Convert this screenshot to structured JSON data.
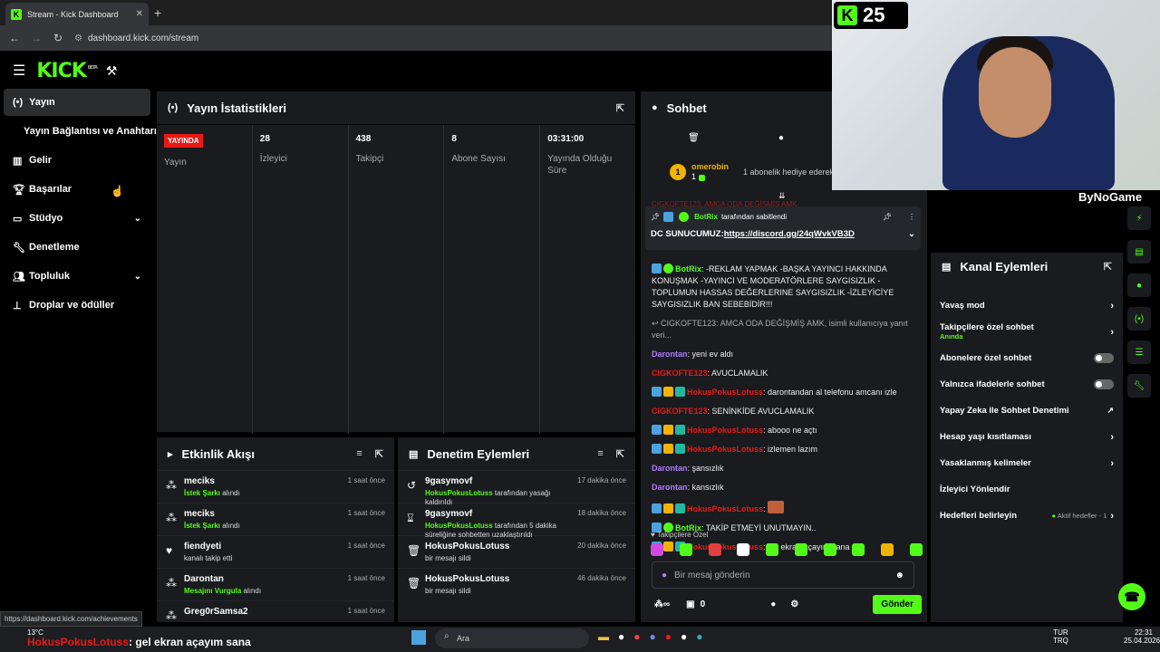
{
  "browser": {
    "tab_title": "Stream - Kick Dashboard",
    "url": "dashboard.kick.com/stream",
    "status_url": "https://dashboard.kick.com/achievements"
  },
  "topnav": {
    "logo": "KICK",
    "beta": "BETA"
  },
  "sidebar": {
    "items": [
      {
        "label": "Yayın",
        "icon": "broadcast-icon"
      },
      {
        "label": "Yayın Bağlantısı ve Anahtarı",
        "icon": ""
      },
      {
        "label": "Gelir",
        "icon": "chart-icon"
      },
      {
        "label": "Başarılar",
        "icon": "trophy-icon"
      },
      {
        "label": "Stüdyo",
        "icon": "studio-icon"
      },
      {
        "label": "Denetleme",
        "icon": "wrench-icon"
      },
      {
        "label": "Topluluk",
        "icon": "community-icon"
      },
      {
        "label": "Droplar ve ödüller",
        "icon": "drops-icon"
      }
    ]
  },
  "stats": {
    "title": "Yayın İstatistikleri",
    "live_badge": "YAYINDA",
    "cols": [
      {
        "value": "",
        "label": "Yayın"
      },
      {
        "value": "28",
        "label": "İzleyici"
      },
      {
        "value": "438",
        "label": "Takipçi"
      },
      {
        "value": "8",
        "label": "Abone Sayısı"
      },
      {
        "value": "03:31:00",
        "label": "Yayında Olduğu Süre"
      }
    ]
  },
  "activity": {
    "title": "Etkinlik Akışı",
    "rows": [
      {
        "name": "meciks",
        "hl": "İstek Şarkı",
        "rest": " alındı",
        "time": "1 saat önce"
      },
      {
        "name": "meciks",
        "hl": "İstek Şarkı",
        "rest": " alındı",
        "time": "1 saat önce"
      },
      {
        "name": "fiendyeti",
        "hl": "",
        "rest": "kanalı takip etti",
        "time": "1 saat önce"
      },
      {
        "name": "Darontan",
        "hl": "Mesajını Vurgula",
        "rest": " alındı",
        "time": "1 saat önce"
      },
      {
        "name": "Greg0rSamsa2",
        "hl": "",
        "rest": "",
        "time": "1 saat önce"
      }
    ]
  },
  "moderation": {
    "title": "Denetim Eylemleri",
    "rows": [
      {
        "name": "9gasymovf",
        "hl": "HokusPokusLotuss",
        "rest": " tarafından yasağı kaldırıldı",
        "time": "17 dakika önce"
      },
      {
        "name": "9gasymovf",
        "hl": "HokusPokusLotuss",
        "rest": " tarafından 5 dakika süreliğine sohbetten uzaklaştırıldı",
        "time": "18 dakika önce"
      },
      {
        "name": "HokusPokusLotuss",
        "hl": "",
        "rest": "bir mesajı sildi",
        "time": "20 dakika önce"
      },
      {
        "name": "HokusPokusLotuss",
        "hl": "",
        "rest": "bir mesajı sildi",
        "time": "46 dakika önce"
      }
    ]
  },
  "chat": {
    "title": "Sohbet",
    "top_user": "omerobin",
    "top_count": "1",
    "gift_text": "1 abonelik hediye ederek",
    "cut_line": "CIGKOFTE123: AMCA ODA DEĞİŞMİŞ AMK",
    "pinned_by": "BotRix",
    "pinned_by_rest": " tarafından sabitlendi",
    "pinned_msg": "DC SUNUCUMUZ: ",
    "pinned_link": "https://discord.gg/24qWvkVB3D",
    "messages": [
      {
        "user": "BotRix",
        "color": "#53fc18",
        "text": ": -REKLAM YAPMAK -BAŞKA YAYINCI HAKKINDA KONUŞMAK -YAYINCI VE MODERATÖRLERE SAYGISIZLIK -TOPLUMUN HASSAS DEĞERLERINE SAYGISIZLIK -İZLEYİCİYE SAYGISIZLIK BAN SEBEBİDİR!!!"
      },
      {
        "user": "",
        "color": "#aaa",
        "text": "↩ CIGKOFTE123: AMCA ODA DEĞİŞMİŞ AMK, isimli kullanıcıya yanıt veri..."
      },
      {
        "user": "Darontan",
        "color": "#b07cff",
        "text": ": yeni ev aldı"
      },
      {
        "user": "CIGKOFTE123",
        "color": "#e91916",
        "text": ": AVUCLAMALIK"
      },
      {
        "user": "HokusPokusLotuss",
        "color": "#e91916",
        "text": ": darontandan al telefonu amcanı izle"
      },
      {
        "user": "CIGKOFTE123",
        "color": "#e91916",
        "text": ": SENİNKİDE AVUCLAMALIK"
      },
      {
        "user": "HokusPokusLotuss",
        "color": "#e91916",
        "text": ": abooo ne açtı"
      },
      {
        "user": "HokusPokusLotuss",
        "color": "#e91916",
        "text": ": izlemen lazım"
      },
      {
        "user": "Darontan",
        "color": "#b07cff",
        "text": ": şansızlık"
      },
      {
        "user": "Darontan",
        "color": "#b07cff",
        "text": ": kansızlık"
      },
      {
        "user": "HokusPokusLotuss",
        "color": "#e91916",
        "text": ":"
      },
      {
        "user": "BotRix",
        "color": "#53fc18",
        "text": ": TAKİP ETMEYİ UNUTMAYIN.."
      },
      {
        "user": "HokusPokusLotuss",
        "color": "#e91916",
        "text": ": gel ekran açayım sana"
      }
    ],
    "emote_label": "Takipçilere Özel",
    "input_placeholder": "Bir mesaj gönderin",
    "points": "0",
    "send": "Gönder"
  },
  "kanal": {
    "title": "Kanal Eylemleri",
    "rows": [
      {
        "label": "Yavaş mod",
        "sub": "",
        "kind": "chev"
      },
      {
        "label": "Takipçilere özel sohbet",
        "sub": "Anında",
        "kind": "chev"
      },
      {
        "label": "Abonelere özel sohbet",
        "sub": "",
        "kind": "toggle"
      },
      {
        "label": "Yalnızca ifadelerle sohbet",
        "sub": "",
        "kind": "toggle"
      },
      {
        "label": "Yapay Zeka ile Sohbet Denetimi",
        "sub": "",
        "kind": "ext"
      },
      {
        "label": "Hesap yaşı kısıtlaması",
        "sub": "",
        "kind": "chev"
      },
      {
        "label": "Yasaklanmış kelimeler",
        "sub": "",
        "kind": "chev"
      },
      {
        "label": "İzleyici Yönlendir",
        "sub": "",
        "kind": "none"
      },
      {
        "label": "Hedefleri belirleyin",
        "sub": "",
        "kind": "chev",
        "extra": "Aktif hedefler - 1"
      }
    ]
  },
  "webcam": {
    "counter": "25",
    "watermark": "ByNoGame"
  },
  "taskbar": {
    "search": "Ara",
    "weather": "13°C",
    "lang1": "TUR",
    "lang2": "TRQ",
    "time": "22:31",
    "date": "25.04.2026"
  },
  "overlay": {
    "name": "HokusPokusLotuss",
    "text": ": gel ekran açayım sana"
  },
  "colors": {
    "accent": "#53fc18",
    "panel": "#191b1f",
    "live": "#e91916"
  }
}
